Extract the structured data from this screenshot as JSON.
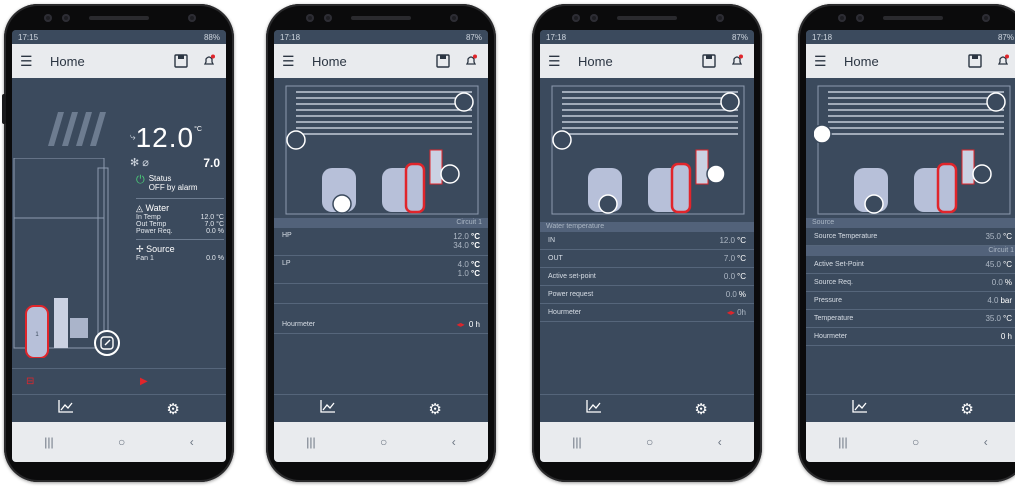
{
  "phones": [
    {
      "status": {
        "time": "17:15",
        "battery": "88%"
      },
      "appbar": {
        "title": "Home"
      },
      "temp_big": "12.0",
      "temp_unit": "°C",
      "temp_small": "7.0",
      "status_label": "Status",
      "status_value": "OFF by alarm",
      "water": {
        "title": "Water",
        "rows": [
          [
            "In Temp",
            "12.0 °C"
          ],
          [
            "Out Temp",
            "7.0 °C"
          ],
          [
            "Power Req.",
            "0.0 %"
          ]
        ]
      },
      "source": {
        "title": "Source",
        "rows": [
          [
            "Fan 1",
            "0.0 %"
          ]
        ]
      },
      "circuit_badge": "1"
    },
    {
      "status": {
        "time": "17:18",
        "battery": "87%"
      },
      "appbar": {
        "title": "Home"
      },
      "circuit": "Circuit 1",
      "rows": [
        {
          "label": "HP",
          "v1": "12.0",
          "u1": "°C",
          "v2": "34.0",
          "u2": "°C"
        },
        {
          "label": "LP",
          "v1": "4.0",
          "u1": "°C",
          "v2": "1.0",
          "u2": "°C"
        }
      ],
      "hourmeter": {
        "label": "Hourmeter",
        "value": "0 h"
      }
    },
    {
      "status": {
        "time": "17:18",
        "battery": "87%"
      },
      "appbar": {
        "title": "Home"
      },
      "section": "Water temperature",
      "rows": [
        {
          "label": "IN",
          "value": "12.0",
          "unit": "°C"
        },
        {
          "label": "OUT",
          "value": "7.0",
          "unit": "°C"
        },
        {
          "label": "Active set-point",
          "value": "0.0",
          "unit": "°C"
        },
        {
          "label": "Power request",
          "value": "0.0",
          "unit": "%"
        }
      ],
      "hourmeter": {
        "label": "Hourmeter",
        "value": "0h"
      }
    },
    {
      "status": {
        "time": "17:18",
        "battery": "87%"
      },
      "appbar": {
        "title": "Home"
      },
      "section": "Source",
      "source_temp": {
        "label": "Source Temperature",
        "value": "35.0",
        "unit": "°C"
      },
      "circuit": "Circuit 1",
      "rows": [
        {
          "label": "Active Set-Point",
          "value": "45.0",
          "unit": "°C"
        },
        {
          "label": "Source Req.",
          "value": "0.0",
          "unit": "%"
        },
        {
          "label": "Pressure",
          "value": "4.0",
          "unit": "bar"
        },
        {
          "label": "Temperature",
          "value": "35.0",
          "unit": "°C"
        },
        {
          "label": "Hourmeter",
          "value": "0 h",
          "unit": ""
        }
      ]
    }
  ],
  "colors": {
    "bg": "#3b4a5d",
    "appbar": "#e9ebee",
    "accent_red": "#e0252b",
    "tank": "#b7c0d9"
  }
}
